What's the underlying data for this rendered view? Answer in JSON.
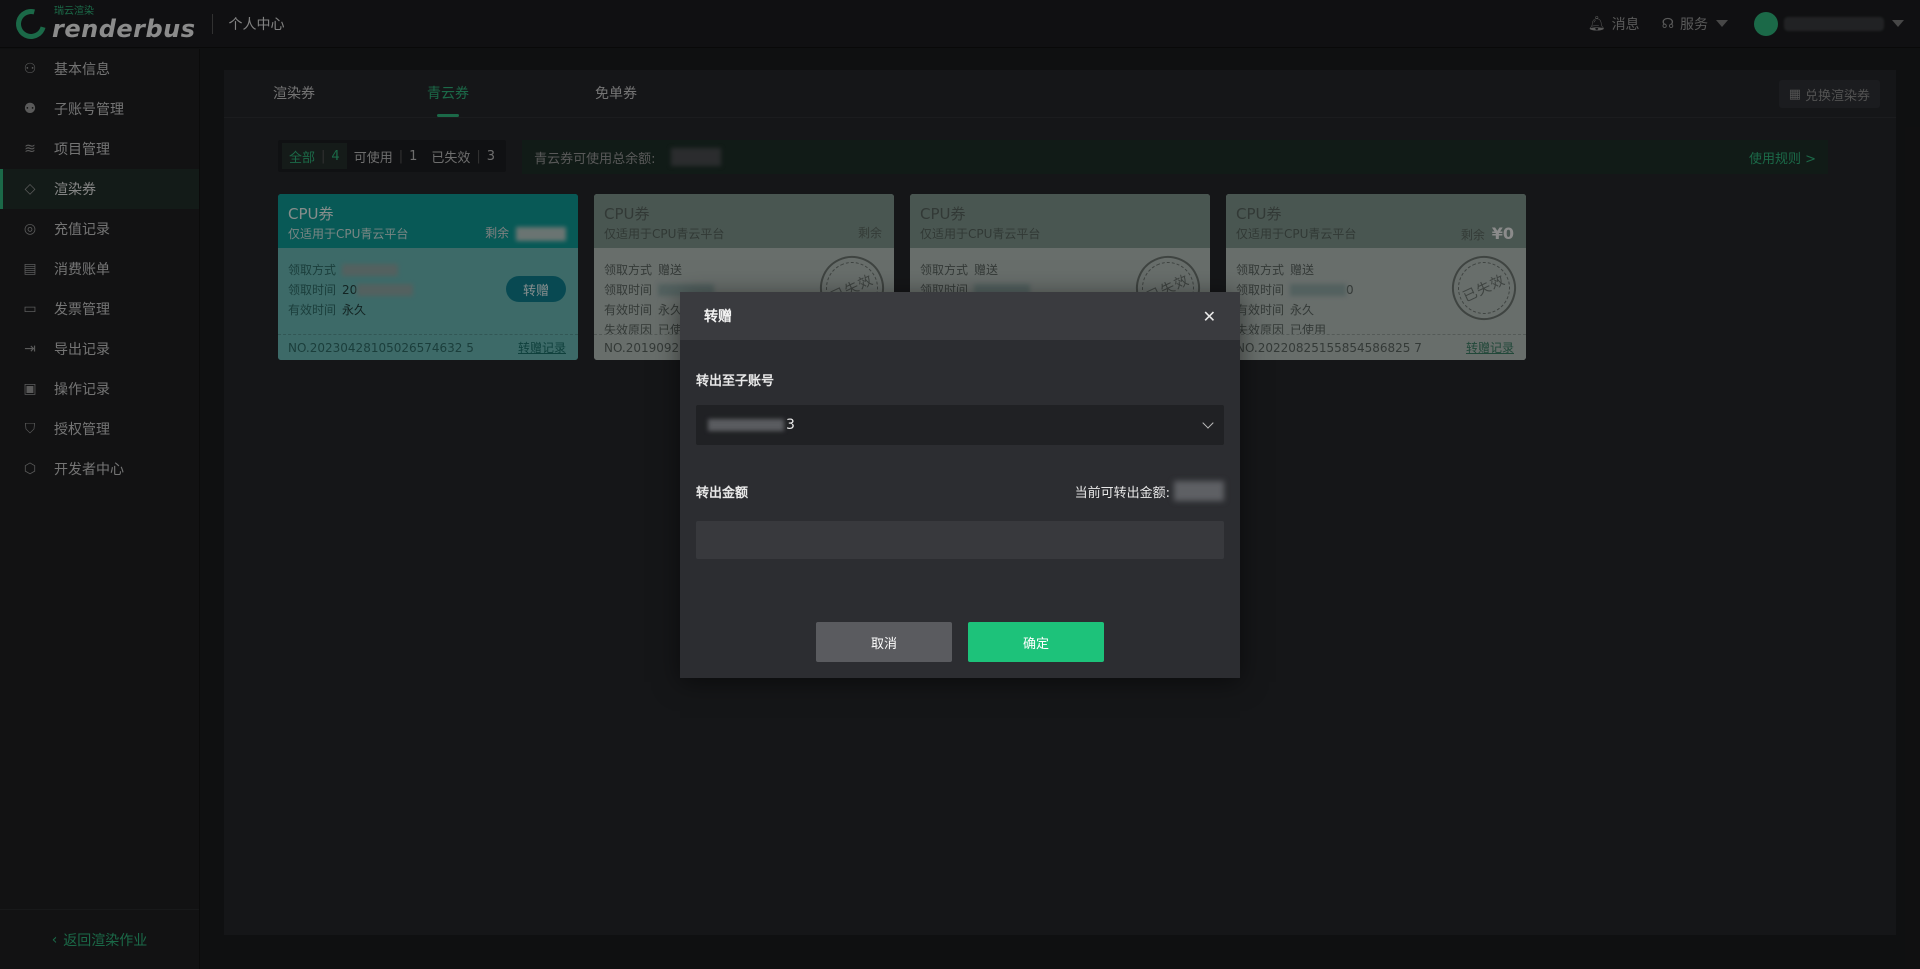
{
  "topbar": {
    "logo_sub": "瑞云渲染",
    "logo_main": "renderbus",
    "title": "个人中心",
    "messages": "消息",
    "service": "服务"
  },
  "sidebar": {
    "items": [
      {
        "label": "基本信息",
        "icon": "user-icon"
      },
      {
        "label": "子账号管理",
        "icon": "users-icon"
      },
      {
        "label": "项目管理",
        "icon": "layers-icon"
      },
      {
        "label": "渲染券",
        "icon": "tag-icon"
      },
      {
        "label": "充值记录",
        "icon": "coin-icon"
      },
      {
        "label": "消费账单",
        "icon": "bill-icon"
      },
      {
        "label": "发票管理",
        "icon": "invoice-icon"
      },
      {
        "label": "导出记录",
        "icon": "export-icon"
      },
      {
        "label": "操作记录",
        "icon": "monitor-icon"
      },
      {
        "label": "授权管理",
        "icon": "shield-icon"
      },
      {
        "label": "开发者中心",
        "icon": "cube-icon"
      }
    ],
    "back_label": "返回渲染作业"
  },
  "tabs": [
    "渲染券",
    "青云券",
    "免单券"
  ],
  "exchange_label": "兑换渲染券",
  "filters": [
    {
      "label": "全部",
      "count": "4"
    },
    {
      "label": "可使用",
      "count": "1"
    },
    {
      "label": "已失效",
      "count": "3"
    }
  ],
  "summary": {
    "label": "青云券可使用总余额:",
    "rule_link": "使用规则 >"
  },
  "coupons": [
    {
      "title": "CPU券",
      "subtitle": "仅适用于CPU青云平台",
      "remain_label": "剩余",
      "rows": [
        {
          "k": "领取方式",
          "v": ""
        },
        {
          "k": "领取时间",
          "v": "20"
        },
        {
          "k": "有效时间",
          "v": "永久"
        }
      ],
      "no": "NO.20230428105026574632 5",
      "give_label": "转赠",
      "record_label": "转赠记录"
    },
    {
      "title": "CPU券",
      "subtitle": "仅适用于CPU青云平台",
      "remain_label": "剩余",
      "rows": [
        {
          "k": "领取方式",
          "v": "赠送"
        },
        {
          "k": "领取时间",
          "v": ""
        },
        {
          "k": "有效时间",
          "v": "永久"
        },
        {
          "k": "失效原因",
          "v": "已使"
        }
      ],
      "no": "NO.20190920",
      "stamp": "已失效",
      "record_label": ""
    },
    {
      "title": "CPU券",
      "subtitle": "仅适用于CPU青云平台",
      "remain_label": "剩余",
      "rows": [
        {
          "k": "领取方式",
          "v": "赠送"
        },
        {
          "k": "领取时间",
          "v": ""
        }
      ],
      "no": "",
      "stamp": "已失效",
      "record_label": ""
    },
    {
      "title": "CPU券",
      "subtitle": "仅适用于CPU青云平台",
      "remain_label": "剩余",
      "remain_value": "¥0",
      "rows": [
        {
          "k": "领取方式",
          "v": "赠送"
        },
        {
          "k": "领取时间",
          "v": "0"
        },
        {
          "k": "有效时间",
          "v": "永久"
        },
        {
          "k": "失效原因",
          "v": "已使用"
        }
      ],
      "no": "NO.20220825155854586825 7",
      "stamp": "已失效",
      "record_label": "转赠记录"
    }
  ],
  "modal": {
    "title": "转赠",
    "to_label": "转出至子账号",
    "selected_account_suffix": "3",
    "amount_label": "转出金额",
    "available_label": "当前可转出金额:",
    "amount_value": "",
    "cancel": "取消",
    "confirm": "确定"
  },
  "colors": {
    "accent": "#2fb67c",
    "confirm_button": "#1dc27a",
    "valid_coupon": "#0e9a95"
  }
}
